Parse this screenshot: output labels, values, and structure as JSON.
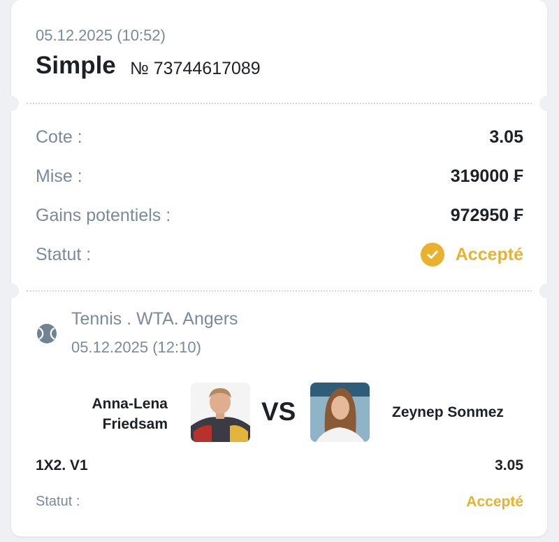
{
  "header": {
    "date": "05.12.2025 (10:52)",
    "bet_type": "Simple",
    "bet_number": "№ 73744617089"
  },
  "summary": {
    "odds_label": "Cote :",
    "odds_value": "3.05",
    "stake_label": "Mise :",
    "stake_value": "319000 ₣",
    "potential_label": "Gains potentiels :",
    "potential_value": "972950 ₣",
    "status_label": "Statut :",
    "status_value": "Accepté"
  },
  "event": {
    "title": "Tennis . WTA. Angers",
    "date": "05.12.2025 (12:10)",
    "player1": "Anna-Lena Friedsam",
    "vs": "VS",
    "player2": "Zeynep Sonmez"
  },
  "selection": {
    "market": "1X2. V1",
    "odds": "3.05",
    "status_label": "Statut :",
    "status_value": "Accepté"
  },
  "colors": {
    "accent": "#e9b22e",
    "muted_text": "#7a8a9a",
    "text": "#1d2026",
    "background": "#eef0f3"
  },
  "icons": {
    "status": "check-circle-icon",
    "sport": "tennis-ball-icon"
  }
}
